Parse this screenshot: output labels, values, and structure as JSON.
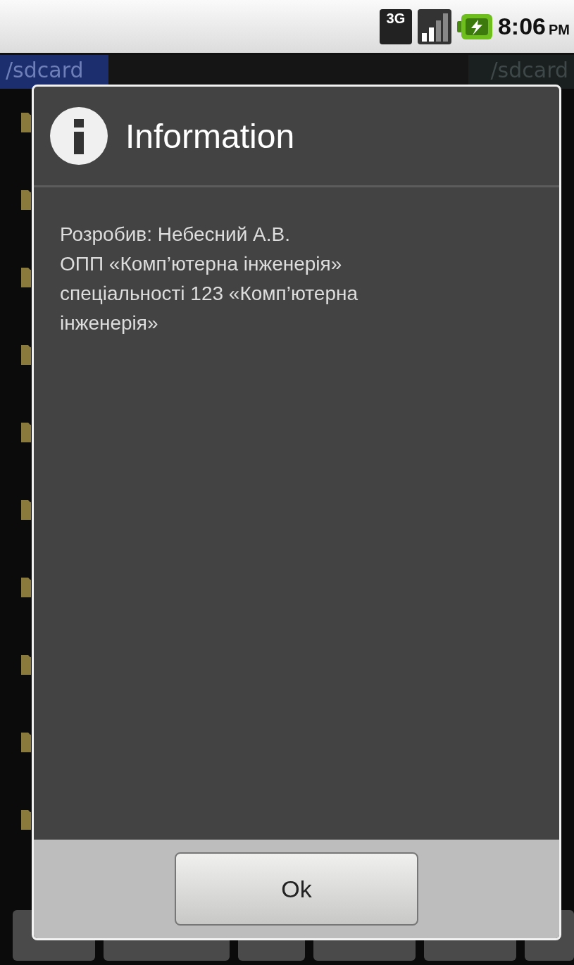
{
  "status_bar": {
    "network": "3G",
    "time": "8:06",
    "period": "PM"
  },
  "path_bar": {
    "left_path": "/sdcard",
    "right_path": "/sdcard"
  },
  "dialog": {
    "title": "Information",
    "lines": [
      "Розробив: Небесний А.В.",
      "ОПП «Комп’ютерна інженерія»",
      "спеціальності 123 «Комп’ютерна інженерія»"
    ],
    "button": "Ok"
  }
}
